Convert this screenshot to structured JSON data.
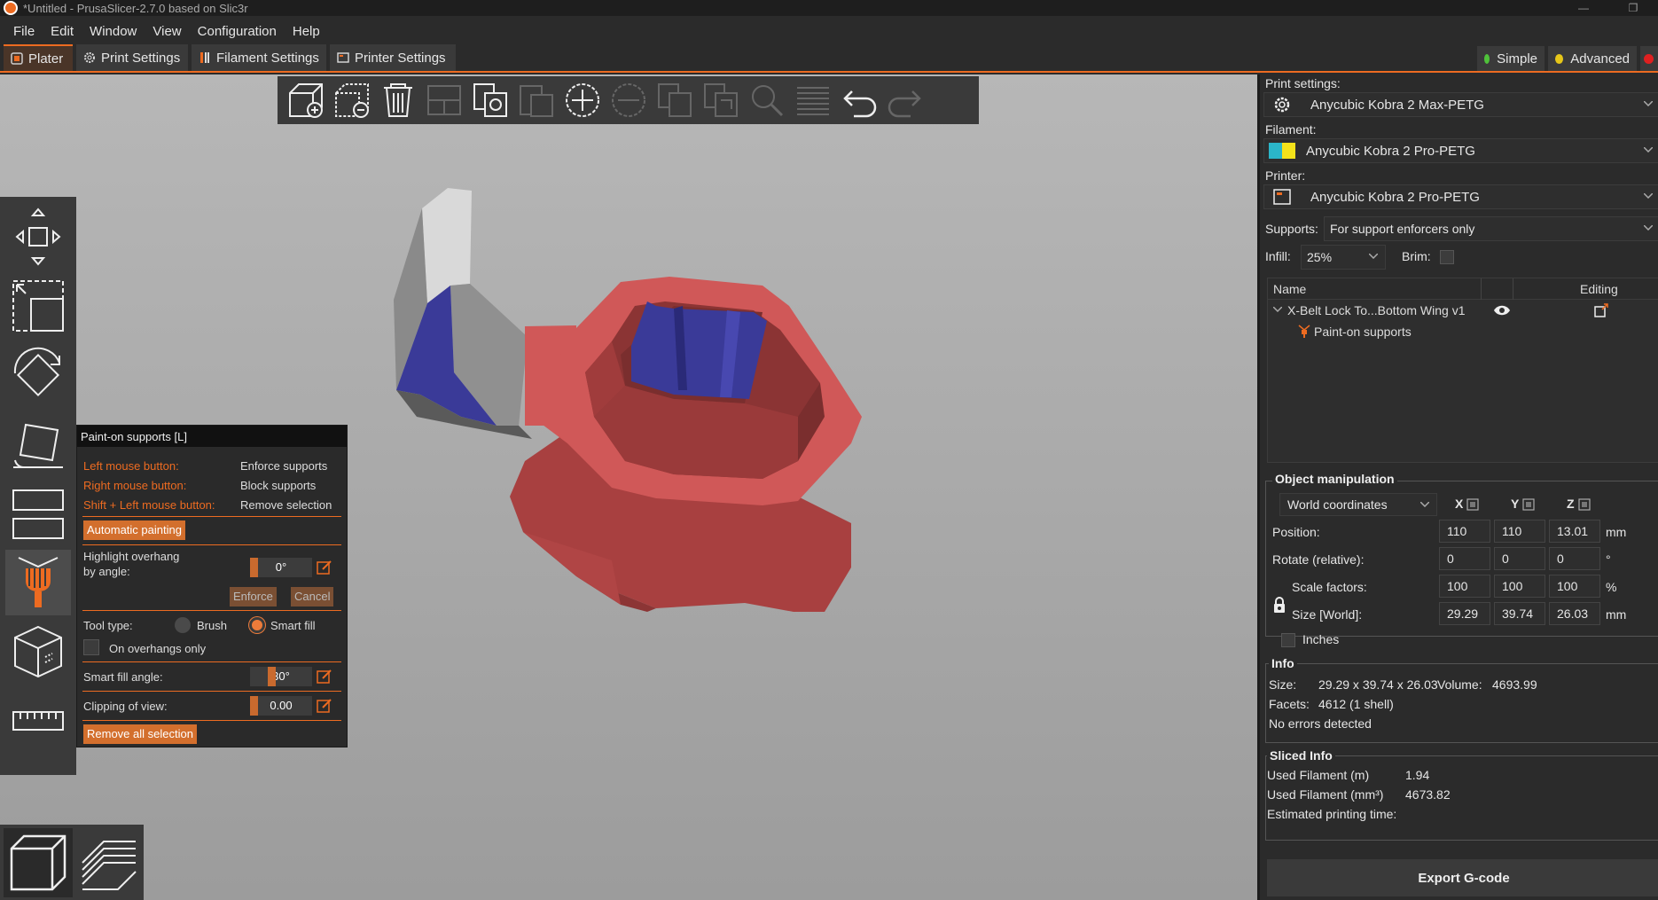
{
  "window": {
    "title": "*Untitled - PrusaSlicer-2.7.0 based on Slic3r"
  },
  "menu": [
    "File",
    "Edit",
    "Window",
    "View",
    "Configuration",
    "Help"
  ],
  "tabs": {
    "plater": "Plater",
    "print": "Print Settings",
    "filament": "Filament Settings",
    "printer": "Printer Settings"
  },
  "modes": {
    "simple": "Simple",
    "advanced": "Advanced"
  },
  "colors": {
    "accent": "#ed6b21",
    "enforce": "#d05858",
    "block": "#3a3a98",
    "simple": "#4fc23a",
    "advanced": "#e6c619",
    "expert": "#e02020"
  },
  "gizmo": {
    "title": "Paint-on supports [L]",
    "left_mouse": "Left mouse button:",
    "left_action": "Enforce supports",
    "right_mouse": "Right mouse button:",
    "right_action": "Block supports",
    "shift_mouse": "Shift + Left mouse button:",
    "shift_action": "Remove selection",
    "auto_paint": "Automatic painting",
    "highlight_label_1": "Highlight overhang",
    "highlight_label_2": "by angle:",
    "highlight_value": "0°",
    "enforce": "Enforce",
    "cancel": "Cancel",
    "tool_type": "Tool type:",
    "brush": "Brush",
    "smart_fill": "Smart fill",
    "overhangs_only": "On overhangs only",
    "smart_fill_angle": "Smart fill angle:",
    "smart_fill_angle_value": "30°",
    "clipping": "Clipping of view:",
    "clipping_value": "0.00",
    "remove_all": "Remove all selection"
  },
  "sidebar": {
    "print_settings_label": "Print settings:",
    "print_settings_value": "Anycubic Kobra 2 Max-PETG",
    "filament_label": "Filament:",
    "filament_value": "Anycubic Kobra 2 Pro-PETG",
    "printer_label": "Printer:",
    "printer_value": "Anycubic Kobra 2 Pro-PETG",
    "supports_label": "Supports:",
    "supports_value": "For support enforcers only",
    "infill_label": "Infill:",
    "infill_value": "25%",
    "brim_label": "Brim:",
    "list_name": "Name",
    "list_editing": "Editing",
    "object_name": "X-Belt Lock To...Bottom Wing v1",
    "object_child": "Paint-on supports"
  },
  "manip": {
    "title": "Object manipulation",
    "coords": "World coordinates",
    "x": "X",
    "y": "Y",
    "z": "Z",
    "position_label": "Position:",
    "position": [
      "110",
      "110",
      "13.01"
    ],
    "position_unit": "mm",
    "rotate_label": "Rotate (relative):",
    "rotate": [
      "0",
      "0",
      "0"
    ],
    "rotate_unit": "°",
    "scale_label": "Scale factors:",
    "scale": [
      "100",
      "100",
      "100"
    ],
    "scale_unit": "%",
    "size_label": "Size [World]:",
    "size": [
      "29.29",
      "39.74",
      "26.03"
    ],
    "size_unit": "mm",
    "inches": "Inches"
  },
  "info": {
    "title": "Info",
    "size_label": "Size:",
    "size_value": "29.29 x 39.74 x 26.03",
    "volume_label": "Volume:",
    "volume_value": "4693.99",
    "facets_label": "Facets:",
    "facets_value": "4612 (1 shell)",
    "errors": "No errors detected"
  },
  "sliced": {
    "title": "Sliced Info",
    "used_m_label": "Used Filament (m)",
    "used_m": "1.94",
    "used_mm3_label": "Used Filament (mm³)",
    "used_mm3": "4673.82",
    "time_label": "Estimated printing time:"
  },
  "export_label": "Export G-code"
}
